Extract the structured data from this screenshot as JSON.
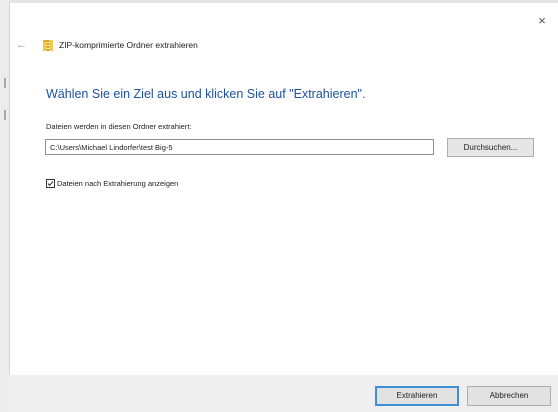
{
  "window": {
    "title": "ZIP-komprimierte Ordner extrahieren",
    "close_glyph": "×",
    "back_glyph": "←"
  },
  "content": {
    "heading": "Wählen Sie ein Ziel aus und klicken Sie auf \"Extrahieren\".",
    "path_label": "Dateien werden in diesen Ordner extrahiert:",
    "path_value": "C:\\Users\\Michael Lindorfer\\test Big-5",
    "browse_label": "Durchsuchen...",
    "show_files_label": "Dateien nach Extrahierung anzeigen",
    "show_files_checked": true
  },
  "footer": {
    "extract_label": "Extrahieren",
    "cancel_label": "Abbrechen"
  },
  "colors": {
    "heading": "#1e4fa3",
    "focus_border": "#3f8fd8",
    "folder_yellow": "#f2c94c",
    "footer_bg": "#efefef"
  },
  "icons": {
    "back": "arrow-left-icon",
    "folder": "zip-folder-icon",
    "close": "close-icon",
    "check": "checkmark-icon"
  }
}
